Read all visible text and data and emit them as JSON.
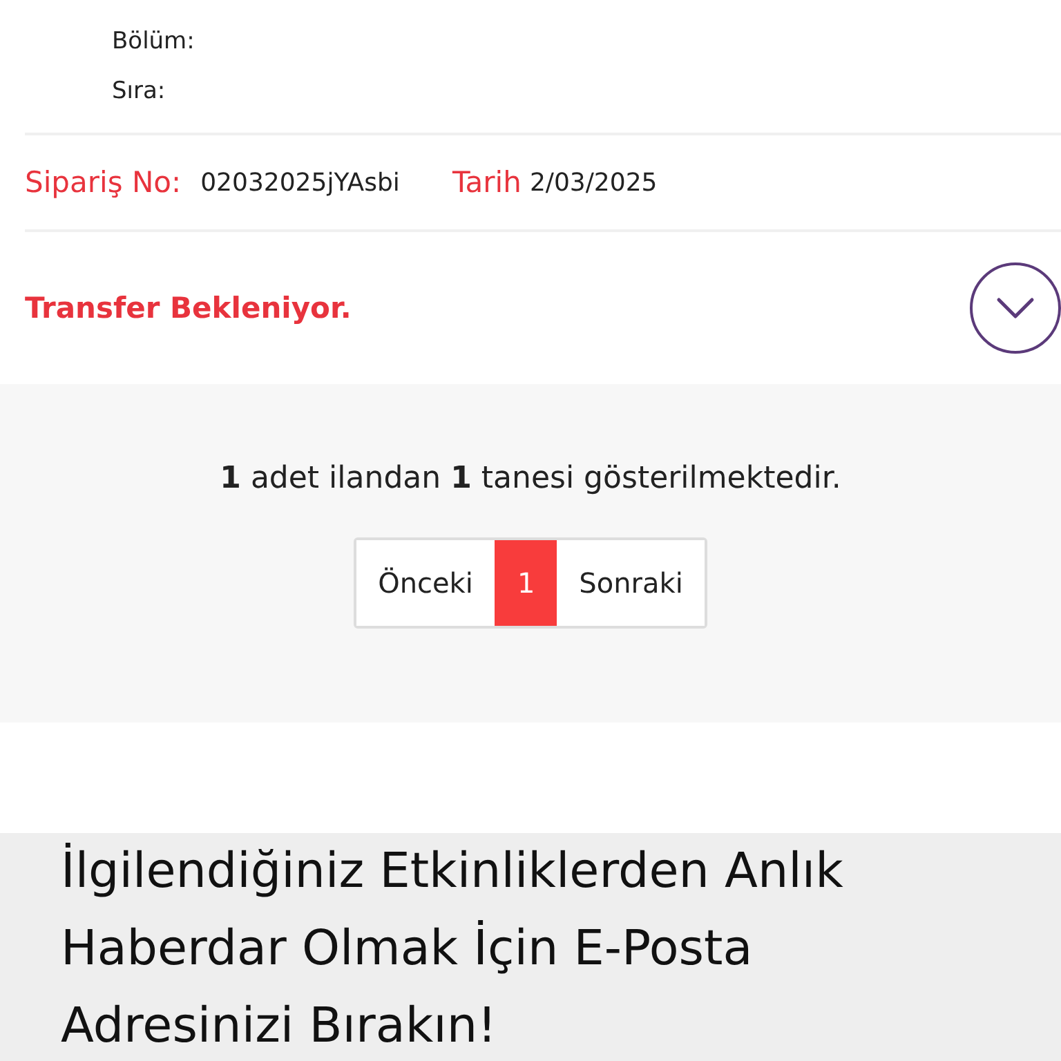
{
  "seat": {
    "lines": [
      {
        "label": "Bölüm:"
      },
      {
        "label": "Sıra:"
      }
    ]
  },
  "order": {
    "number_label": "Sipariş No:",
    "number": "02032025jYAsbi",
    "date_label": "Tarih",
    "date": "2/03/2025"
  },
  "status": {
    "text": "Transfer Bekleniyor.",
    "expanded": false
  },
  "results": {
    "summary": "**1** adet ilandan **1** tanesi gösterilmektedir.",
    "pagination": [
      {
        "label": "Önceki",
        "selected": false
      },
      {
        "label": "1",
        "selected": true
      },
      {
        "label": "Sonraki",
        "selected": false
      }
    ]
  },
  "newsletter": {
    "heading": "İlgilendiğiniz Etkinliklerden Anlık Haberdar Olmak İçin E-Posta Adresinizi Bırakın!"
  }
}
